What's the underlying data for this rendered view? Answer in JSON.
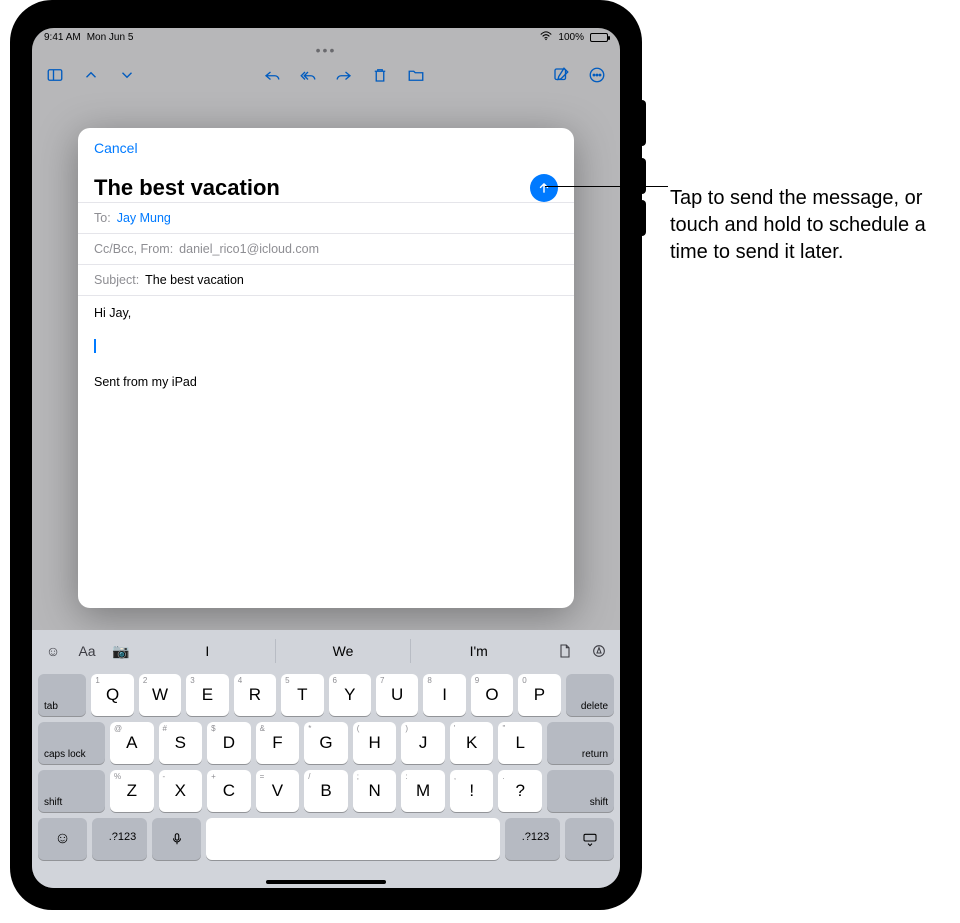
{
  "status": {
    "time": "9:41 AM",
    "date": "Mon Jun 5",
    "battery_pct": "100%"
  },
  "toolbar_icons": [
    "sidebar",
    "up",
    "down",
    "reply",
    "reply-all",
    "forward",
    "trash",
    "folder",
    "compose",
    "more"
  ],
  "compose": {
    "cancel": "Cancel",
    "title": "The best vacation",
    "to_label": "To:",
    "to_value": "Jay Mung",
    "cc_label": "Cc/Bcc, From:",
    "cc_value": "daniel_rico1@icloud.com",
    "subject_label": "Subject:",
    "subject_value": "The best vacation",
    "body_greeting": "Hi Jay,",
    "signature": "Sent from my iPad"
  },
  "keyboard": {
    "predictions": [
      "I",
      "We",
      "I'm"
    ],
    "row1": [
      {
        "m": "Q",
        "a": "1"
      },
      {
        "m": "W",
        "a": "2"
      },
      {
        "m": "E",
        "a": "3"
      },
      {
        "m": "R",
        "a": "4"
      },
      {
        "m": "T",
        "a": "5"
      },
      {
        "m": "Y",
        "a": "6"
      },
      {
        "m": "U",
        "a": "7"
      },
      {
        "m": "I",
        "a": "8"
      },
      {
        "m": "O",
        "a": "9"
      },
      {
        "m": "P",
        "a": "0"
      }
    ],
    "row2": [
      {
        "m": "A",
        "a": "@"
      },
      {
        "m": "S",
        "a": "#"
      },
      {
        "m": "D",
        "a": "$"
      },
      {
        "m": "F",
        "a": "&"
      },
      {
        "m": "G",
        "a": "*"
      },
      {
        "m": "H",
        "a": "("
      },
      {
        "m": "J",
        "a": ")"
      },
      {
        "m": "K",
        "a": "'"
      },
      {
        "m": "L",
        "a": "\""
      }
    ],
    "row3": [
      {
        "m": "Z",
        "a": "%"
      },
      {
        "m": "X",
        "a": "-"
      },
      {
        "m": "C",
        "a": "+"
      },
      {
        "m": "V",
        "a": "="
      },
      {
        "m": "B",
        "a": "/"
      },
      {
        "m": "N",
        "a": ";"
      },
      {
        "m": "M",
        "a": ":"
      },
      {
        "m": "!",
        "a": ","
      },
      {
        "m": "?",
        "a": "."
      }
    ],
    "tab": "tab",
    "delete": "delete",
    "caps": "caps lock",
    "return": "return",
    "shift": "shift",
    "numsym": ".?123"
  },
  "callout": "Tap to send the message, or touch and hold to schedule a time to send it later."
}
